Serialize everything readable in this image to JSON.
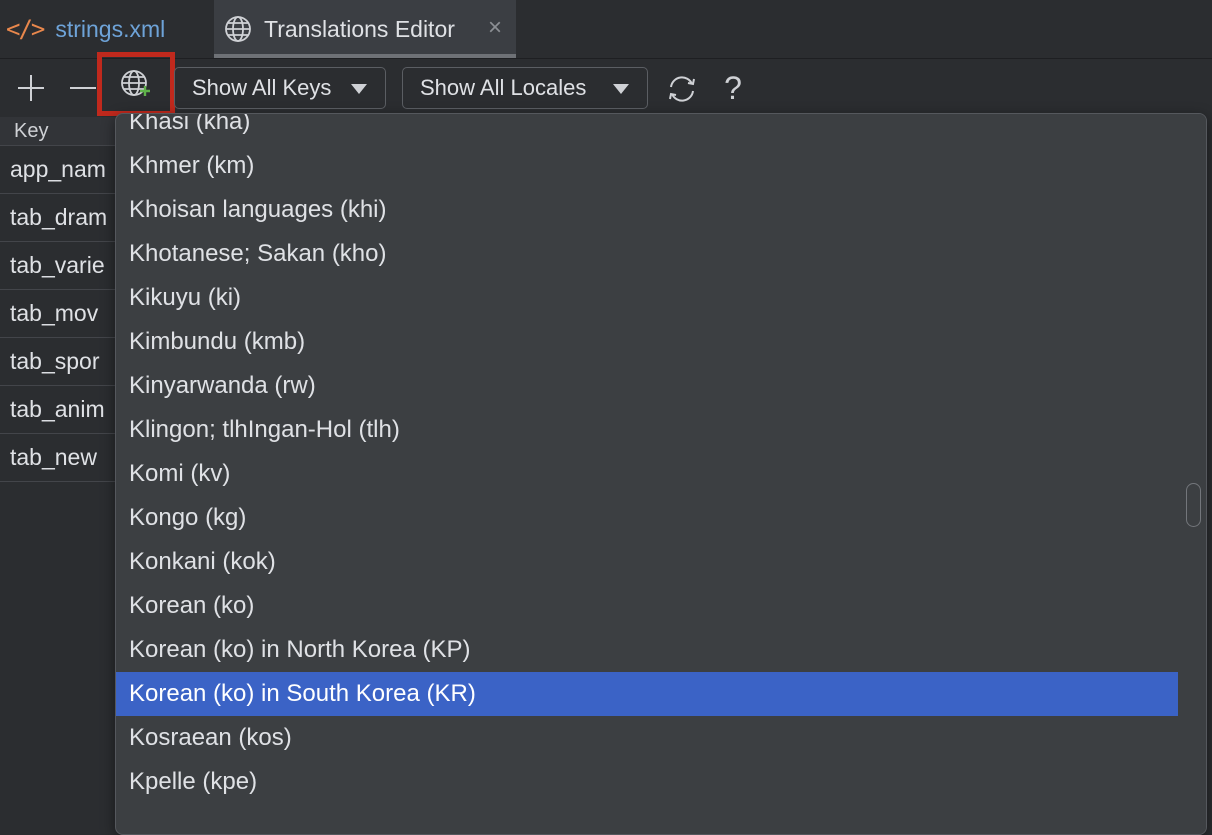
{
  "tabs": [
    {
      "label": "strings.xml",
      "icon": "xml-code-icon",
      "active": false
    },
    {
      "label": "Translations Editor",
      "icon": "globe-icon",
      "active": true,
      "close": "×"
    }
  ],
  "toolbar": {
    "add_icon": "plus-icon",
    "remove_icon": "minus-icon",
    "add_locale_icon": "globe-plus-icon",
    "keys_filter": "Show All Keys",
    "locales_filter": "Show All Locales",
    "reload_icon": "refresh-icon",
    "help_label": "?"
  },
  "key_table": {
    "header": "Key",
    "rows": [
      "app_nam",
      "tab_dram",
      "tab_varie",
      "tab_mov",
      "tab_spor",
      "tab_anim",
      "tab_new"
    ]
  },
  "locale_list": {
    "items": [
      "Khasi (kha)",
      "Khmer (km)",
      "Khoisan languages (khi)",
      "Khotanese; Sakan (kho)",
      "Kikuyu (ki)",
      "Kimbundu (kmb)",
      "Kinyarwanda (rw)",
      "Klingon; tlhIngan-Hol (tlh)",
      "Komi (kv)",
      "Kongo (kg)",
      "Konkani (kok)",
      "Korean (ko)",
      "Korean (ko) in North Korea (KP)",
      "Korean (ko) in South Korea (KR)",
      "Kosraean (kos)",
      "Kpelle (kpe)"
    ],
    "selected": "Korean (ko) in South Korea (KR)"
  },
  "colors": {
    "highlight_box": "#c0291d",
    "selection": "#3b63c6",
    "xml_icon": "#e8874c",
    "inactive_tab_text": "#6ea3d8"
  }
}
